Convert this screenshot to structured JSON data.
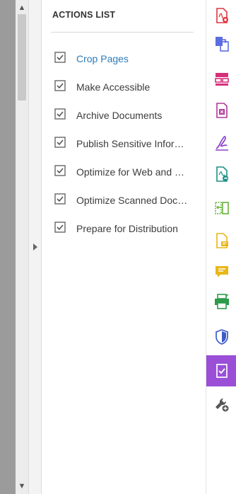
{
  "panel": {
    "title": "ACTIONS LIST",
    "actions": [
      {
        "label": "Crop Pages",
        "active": true
      },
      {
        "label": "Make Accessible",
        "active": false
      },
      {
        "label": "Archive Documents",
        "active": false
      },
      {
        "label": "Publish Sensitive Inform...",
        "active": false
      },
      {
        "label": "Optimize for Web and M...",
        "active": false
      },
      {
        "label": "Optimize Scanned Docu...",
        "active": false
      },
      {
        "label": "Prepare for Distribution",
        "active": false
      }
    ]
  },
  "tools": [
    {
      "icon": "create-pdf-icon",
      "color": "#e0343f"
    },
    {
      "icon": "export-pdf-icon",
      "color": "#5b6ee1"
    },
    {
      "icon": "organize-pages-icon",
      "color": "#d6307a"
    },
    {
      "icon": "compress-pdf-icon",
      "color": "#b1399d"
    },
    {
      "icon": "fill-sign-icon",
      "color": "#8a3fcf"
    },
    {
      "icon": "send-for-review-icon",
      "color": "#1e8f86"
    },
    {
      "icon": "compare-files-icon",
      "color": "#69b33b"
    },
    {
      "icon": "comment-pdf-icon",
      "color": "#e8b619"
    },
    {
      "icon": "comment-icon",
      "color": "#e8b619"
    },
    {
      "icon": "print-production-icon",
      "color": "#2c9b4a"
    },
    {
      "icon": "protect-icon",
      "color": "#3c5bc7"
    },
    {
      "icon": "action-wizard-icon",
      "color": "#9a4fd6",
      "selected": true
    },
    {
      "icon": "more-tools-icon",
      "color": "#555555"
    }
  ]
}
